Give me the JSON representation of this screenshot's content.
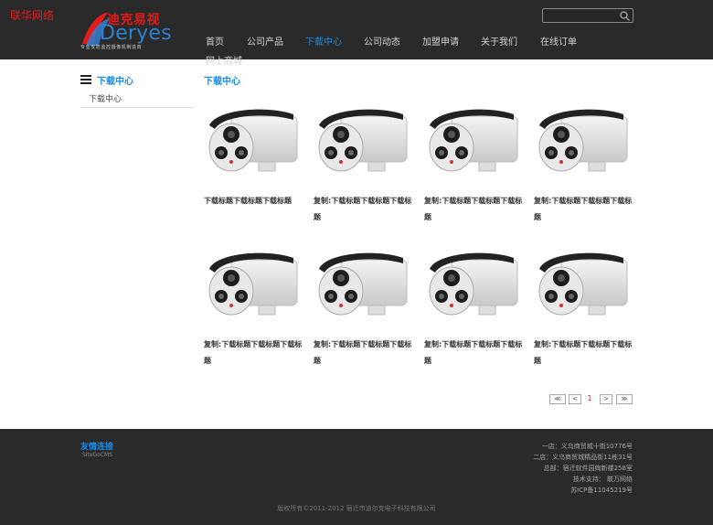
{
  "watermark": "联华网络",
  "logo": {
    "cn": "迪克易视",
    "en": "Deryes",
    "tagline": "专业安防监控摄像机制造商"
  },
  "search": {
    "placeholder": "",
    "value": ""
  },
  "nav": {
    "items": [
      {
        "label": "首页",
        "active": false
      },
      {
        "label": "公司产品",
        "active": false
      },
      {
        "label": "下载中心",
        "active": true
      },
      {
        "label": "公司动态",
        "active": false
      },
      {
        "label": "加盟申请",
        "active": false
      },
      {
        "label": "关于我们",
        "active": false
      },
      {
        "label": "在线订单",
        "active": false
      },
      {
        "label": "网上商城",
        "active": false
      }
    ]
  },
  "sidebar": {
    "title": "下载中心",
    "items": [
      {
        "label": "下载中心"
      }
    ]
  },
  "main": {
    "title": "下载中心",
    "downloads": [
      {
        "caption": "下载标题下载标题下载标题"
      },
      {
        "caption": "复制:下载标题下载标题下载标题"
      },
      {
        "caption": "复制:下载标题下载标题下载标题"
      },
      {
        "caption": "复制:下载标题下载标题下载标题"
      },
      {
        "caption": "复制:下载标题下载标题下载标题"
      },
      {
        "caption": "复制:下载标题下载标题下载标题"
      },
      {
        "caption": "复制:下载标题下载标题下载标题"
      },
      {
        "caption": "复制:下载标题下载标题下载标题"
      }
    ]
  },
  "pagination": {
    "first": "≪",
    "prev": "<",
    "current": "1",
    "next": ">",
    "last": "≫"
  },
  "footer": {
    "links_title": "友情连接",
    "links": [
      "SiteGoCMS"
    ],
    "address_lines": [
      "一店：义乌商贸城十街10776号",
      "二店：义乌商贸城精品街11栋31号",
      "总部：宿迁软件园绚新楼258室",
      "技术支持： 联万网络",
      "苏ICP备11045219号"
    ],
    "copyright": "版权所有©2011-2012  宿迁市迪尔克电子科技有限公司"
  },
  "colors": {
    "header_bg": "#2a2a2a",
    "accent": "#1a8ce8",
    "brand_red": "#e21b1b"
  }
}
